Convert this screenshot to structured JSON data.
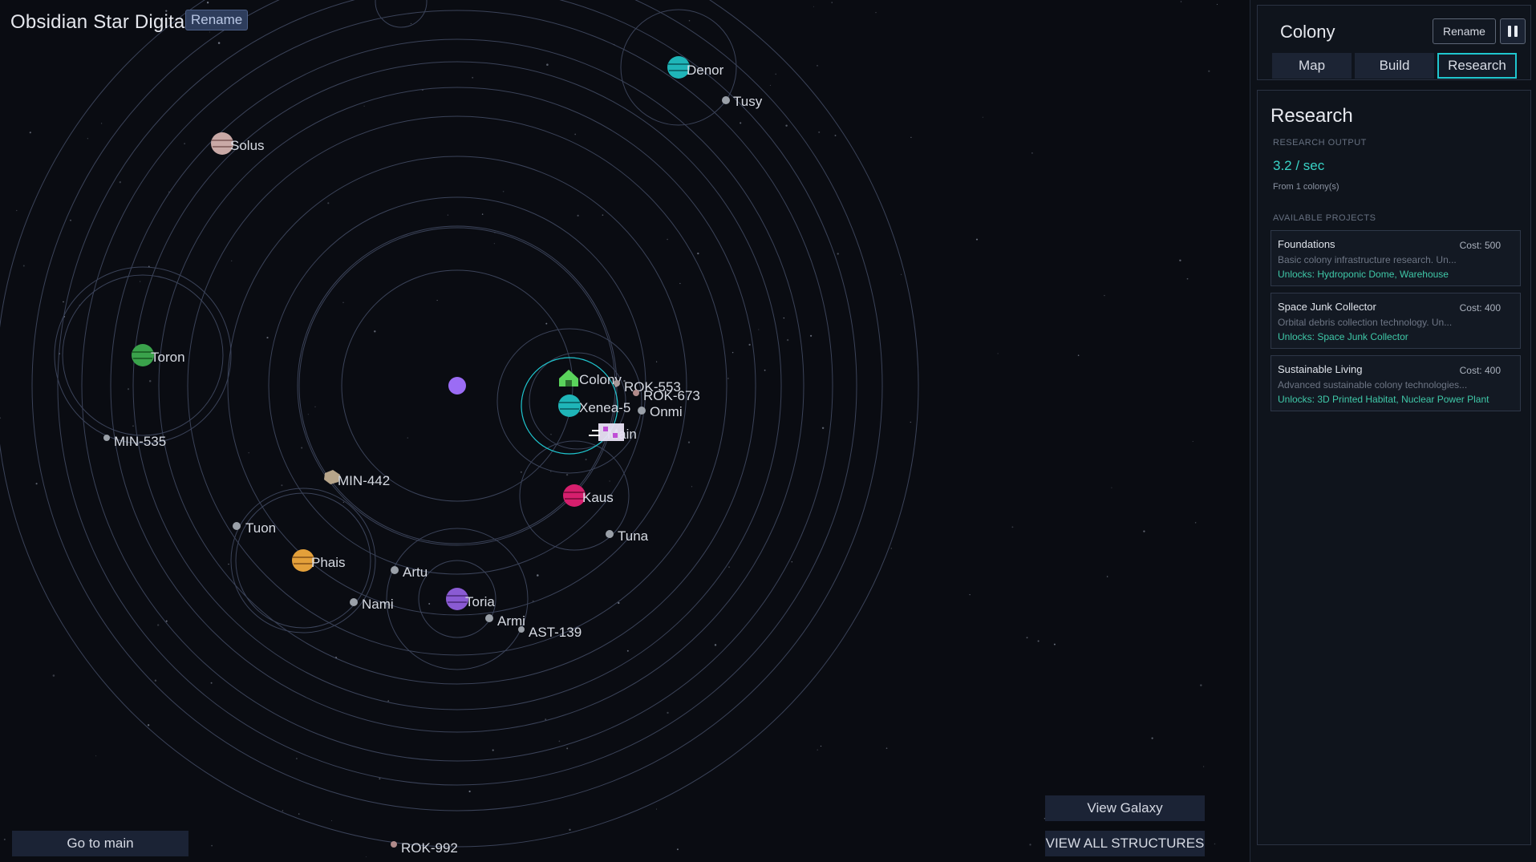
{
  "system": {
    "title": "Obsidian Star Digital",
    "rename_label": "Rename"
  },
  "map_buttons": {
    "go_main": "Go to main",
    "view_galaxy": "View Galaxy",
    "view_structures": "VIEW ALL STRUCTURES"
  },
  "bodies": {
    "denor": "Denor",
    "tusy": "Tusy",
    "solus": "Solus",
    "toron": "Toron",
    "min535": "MIN-535",
    "min442": "MIN-442",
    "tuon": "Tuon",
    "phais": "Phais",
    "nami": "Nami",
    "artu": "Artu",
    "toria": "Toria",
    "armi": "Armi",
    "ast139": "AST-139",
    "kaus": "Kaus",
    "tuna": "Tuna",
    "colony": "Colony",
    "xenea": "Xenea-5",
    "rok553": "ROK-553",
    "rok673": "ROK-673",
    "onmi": "Onmi",
    "main": "Main",
    "rok992": "ROK-992"
  },
  "colony_panel": {
    "title": "Colony",
    "rename_label": "Rename",
    "tabs": [
      {
        "label": "Map"
      },
      {
        "label": "Build"
      },
      {
        "label": "Research"
      }
    ]
  },
  "research": {
    "title": "Research",
    "output_caption": "RESEARCH OUTPUT",
    "rate": "3.2 / sec",
    "from": "From 1 colony(s)",
    "projects_caption": "AVAILABLE PROJECTS",
    "projects": [
      {
        "name": "Foundations",
        "cost": "Cost: 500",
        "desc": "Basic colony infrastructure research. Un...",
        "unlocks": "Unlocks: Hydroponic Dome, Warehouse"
      },
      {
        "name": "Space Junk Collector",
        "cost": "Cost: 400",
        "desc": "Orbital debris collection technology. Un...",
        "unlocks": "Unlocks: Space Junk Collector"
      },
      {
        "name": "Sustainable Living",
        "cost": "Cost: 400",
        "desc": "Advanced sustainable colony technologies...",
        "unlocks": "Unlocks: 3D Printed Habitat, Nuclear Power Plant"
      }
    ]
  },
  "icons": {
    "pause": "pause-icon",
    "home": "home-icon",
    "ship": "ship-icon",
    "star": "star-icon"
  },
  "colors": {
    "accent": "#1fc6cf",
    "rate": "#39d3c6",
    "unlock": "#3fc8a8",
    "star": "#9b6cf5"
  }
}
